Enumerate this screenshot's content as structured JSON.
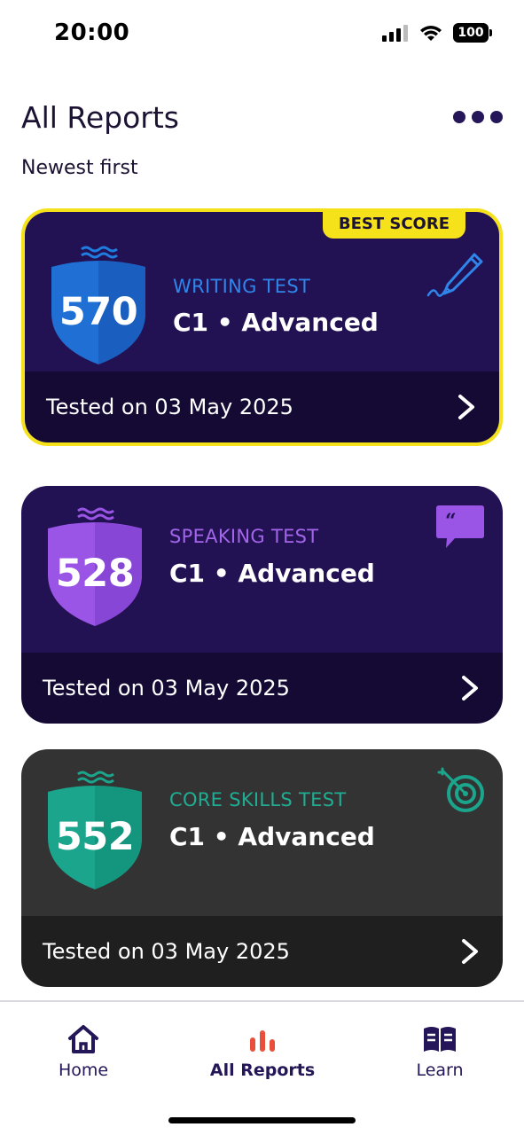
{
  "status_bar": {
    "time": "20:00",
    "battery": "100"
  },
  "header": {
    "title": "All Reports",
    "subtitle": "Newest first",
    "more_icon": "more-horizontal-icon"
  },
  "reports": [
    {
      "badge": "BEST SCORE",
      "score": "570",
      "test_name": "WRITING TEST",
      "level_code": "C1",
      "level_name": "Advanced",
      "level": "C1 • Advanced",
      "tested": "Tested on 03 May 2025",
      "icon": "pen-icon",
      "accent": "#1f7de0"
    },
    {
      "score": "528",
      "test_name": "SPEAKING TEST",
      "level_code": "C1",
      "level_name": "Advanced",
      "level": "C1 • Advanced",
      "tested": "Tested on 03 May 2025",
      "icon": "speech-bubble-icon",
      "accent": "#9b55e6"
    },
    {
      "score": "552",
      "test_name": "CORE SKILLS TEST",
      "level_code": "C1",
      "level_name": "Advanced",
      "level": "C1 • Advanced",
      "tested": "Tested on 03 May 2025",
      "icon": "target-icon",
      "accent": "#1aa58c"
    }
  ],
  "nav": {
    "home": "Home",
    "reports": "All Reports",
    "learn": "Learn",
    "active": "All Reports"
  },
  "colors": {
    "best_border": "#f5e21a",
    "brand_dark": "#241658",
    "reports_active": "#e8503c"
  }
}
